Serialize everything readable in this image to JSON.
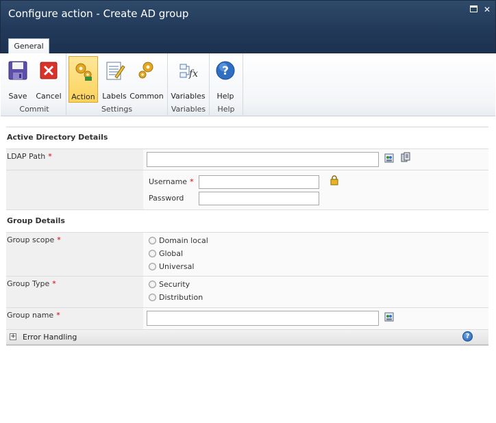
{
  "window": {
    "title": "Configure action - Create AD group",
    "maximize_icon": "maximize-icon",
    "close_icon": "close-icon"
  },
  "tabs": [
    {
      "label": "General",
      "active": true
    }
  ],
  "ribbon": {
    "buttons": [
      {
        "label": "Save",
        "icon": "save-disk-icon"
      },
      {
        "label": "Cancel",
        "icon": "cancel-x-icon"
      },
      {
        "label": "Action",
        "icon": "action-gears-icon",
        "active": true
      },
      {
        "label": "Labels",
        "icon": "labels-notepad-icon"
      },
      {
        "label": "Common",
        "icon": "common-gears-icon"
      },
      {
        "label": "Variables",
        "icon": "variables-fx-icon"
      },
      {
        "label": "Help",
        "icon": "help-question-icon"
      }
    ],
    "groups": [
      {
        "label": "Commit"
      },
      {
        "label": "Settings"
      },
      {
        "label": "Variables"
      },
      {
        "label": "Help"
      }
    ]
  },
  "sections": {
    "active_directory": "Active Directory Details",
    "group_details": "Group Details"
  },
  "fields": {
    "ldap_path": {
      "label": "LDAP Path",
      "required": "*",
      "value": ""
    },
    "username": {
      "label": "Username",
      "required": "*",
      "value": ""
    },
    "password": {
      "label": "Password",
      "value": ""
    },
    "group_scope": {
      "label": "Group scope",
      "required": "*",
      "options": [
        "Domain local",
        "Global",
        "Universal"
      ]
    },
    "group_type": {
      "label": "Group Type",
      "required": "*",
      "options": [
        "Security",
        "Distribution"
      ]
    },
    "group_name": {
      "label": "Group name",
      "required": "*",
      "value": ""
    }
  },
  "error_handling": {
    "label": "Error Handling",
    "expand_icon": "+",
    "help_icon": "?"
  },
  "colors": {
    "titlebar": "#22395a",
    "active_button": "#fbd35b",
    "required": "#cc0000",
    "help_blue": "#1d5fb5"
  }
}
